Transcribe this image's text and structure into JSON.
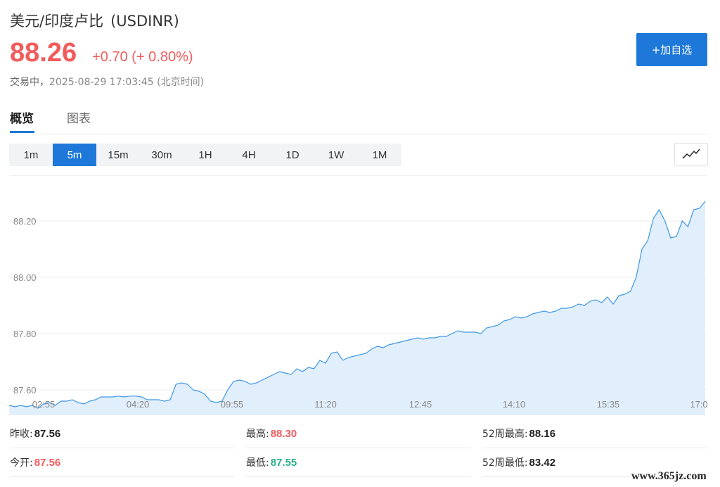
{
  "header": {
    "name": "美元/印度卢比",
    "code": "(USDINR)",
    "price": "88.26",
    "change": "+0.70 (+ 0.80%)",
    "status": "交易中，",
    "timestamp": "2025-08-29 17:03:45 (北京时间)",
    "add_button": "+加自选"
  },
  "colors": {
    "up": "#f25b5b",
    "down": "#25b08a",
    "accent": "#1e78d9",
    "line": "#3f98e6",
    "area": "#e1eefc"
  },
  "tabs": [
    {
      "label": "概览",
      "active": true
    },
    {
      "label": "图表",
      "active": false
    }
  ],
  "periods": [
    {
      "label": "1m",
      "active": false
    },
    {
      "label": "5m",
      "active": true
    },
    {
      "label": "15m",
      "active": false
    },
    {
      "label": "30m",
      "active": false
    },
    {
      "label": "1H",
      "active": false
    },
    {
      "label": "4H",
      "active": false
    },
    {
      "label": "1D",
      "active": false
    },
    {
      "label": "1W",
      "active": false
    },
    {
      "label": "1M",
      "active": false
    }
  ],
  "chart_type_icon": "line-chart-icon",
  "chart_data": {
    "type": "area",
    "x_ticks": [
      "02:55",
      "04:20",
      "09:55",
      "11:20",
      "12:45",
      "14:10",
      "15:35",
      "17:0"
    ],
    "y_ticks": [
      "88.20",
      "88.00",
      "87.80",
      "87.60"
    ],
    "ylim": [
      87.51,
      88.36
    ],
    "grid": true,
    "values": [
      87.545,
      87.54,
      87.545,
      87.54,
      87.545,
      87.535,
      87.55,
      87.555,
      87.545,
      87.56,
      87.56,
      87.565,
      87.555,
      87.55,
      87.56,
      87.565,
      87.575,
      87.575,
      87.575,
      87.578,
      87.575,
      87.578,
      87.578,
      87.575,
      87.565,
      87.565,
      87.565,
      87.56,
      87.565,
      87.62,
      87.625,
      87.62,
      87.6,
      87.595,
      87.585,
      87.56,
      87.555,
      87.56,
      87.6,
      87.63,
      87.635,
      87.63,
      87.62,
      87.625,
      87.635,
      87.645,
      87.655,
      87.665,
      87.66,
      87.655,
      87.675,
      87.665,
      87.68,
      87.675,
      87.705,
      87.695,
      87.73,
      87.735,
      87.705,
      87.715,
      87.72,
      87.725,
      87.73,
      87.745,
      87.755,
      87.75,
      87.76,
      87.765,
      87.77,
      87.775,
      87.78,
      87.785,
      87.78,
      87.785,
      87.785,
      87.79,
      87.79,
      87.8,
      87.81,
      87.805,
      87.805,
      87.805,
      87.8,
      87.82,
      87.825,
      87.83,
      87.845,
      87.85,
      87.86,
      87.855,
      87.86,
      87.87,
      87.875,
      87.88,
      87.875,
      87.88,
      87.89,
      87.89,
      87.895,
      87.905,
      87.9,
      87.915,
      87.92,
      87.91,
      87.93,
      87.905,
      87.935,
      87.94,
      87.95,
      88.0,
      88.1,
      88.13,
      88.21,
      88.24,
      88.2,
      88.14,
      88.145,
      88.2,
      88.18,
      88.24,
      88.245,
      88.27
    ]
  },
  "stats": [
    [
      {
        "label": "昨收:",
        "value": "87.56",
        "tone": "black"
      },
      {
        "label": "最高:",
        "value": "88.30",
        "tone": "red"
      },
      {
        "label": "52周最高:",
        "value": "88.16",
        "tone": "black"
      }
    ],
    [
      {
        "label": "今开:",
        "value": "87.56",
        "tone": "red"
      },
      {
        "label": "最低:",
        "value": "87.55",
        "tone": "green"
      },
      {
        "label": "52周最低:",
        "value": "83.42",
        "tone": "black"
      }
    ]
  ],
  "watermark": "www.365jz.com"
}
